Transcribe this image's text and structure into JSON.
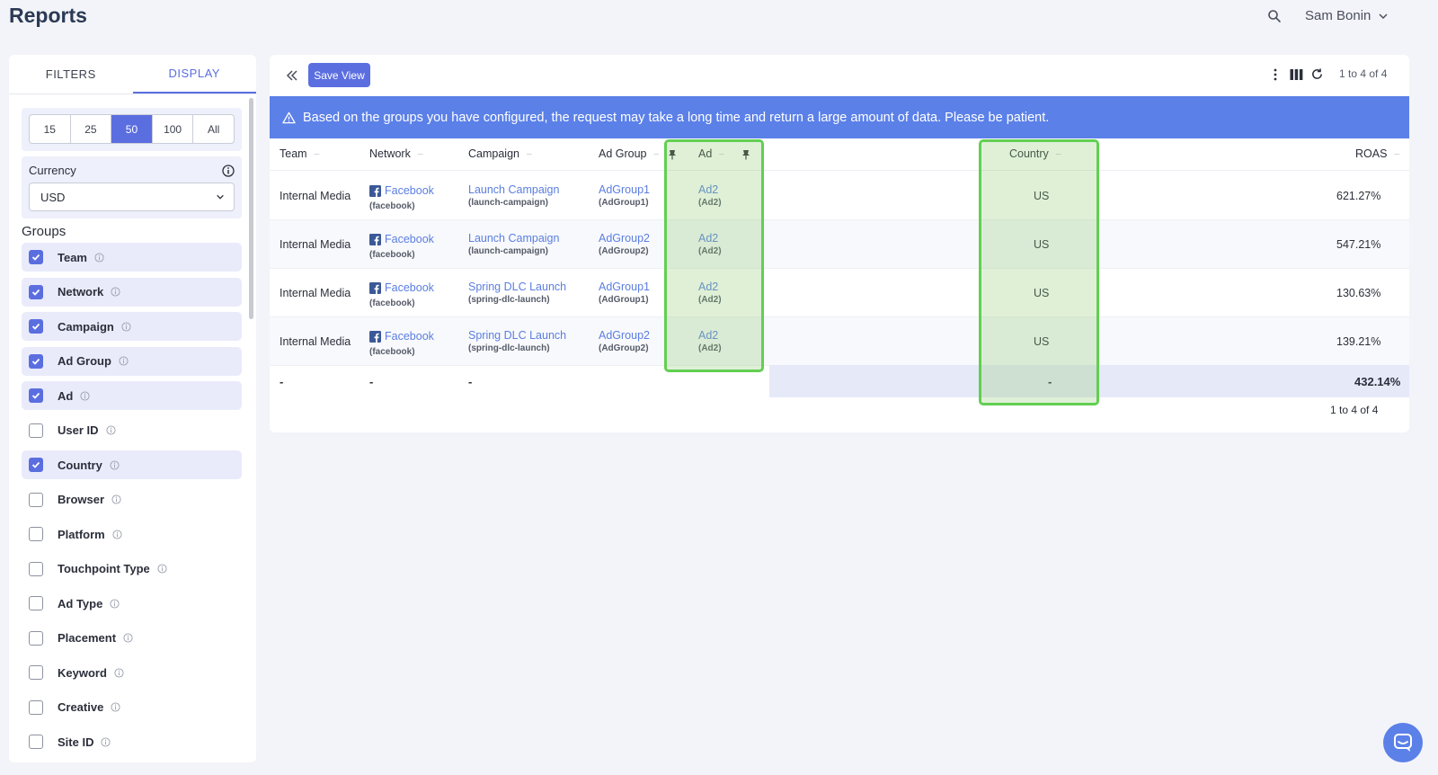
{
  "app": {
    "title": "Reports",
    "user_name": "Sam Bonin"
  },
  "sidebar": {
    "tabs": [
      {
        "label": "FILTERS"
      },
      {
        "label": "DISPLAY"
      }
    ],
    "page_sizes": [
      {
        "label": "15"
      },
      {
        "label": "25"
      },
      {
        "label": "50"
      },
      {
        "label": "100"
      },
      {
        "label": "All"
      }
    ],
    "selected_page_size": "50",
    "currency_label": "Currency",
    "currency_value": "USD",
    "groups_label": "Groups",
    "groups": [
      {
        "label": "Team",
        "checked": true
      },
      {
        "label": "Network",
        "checked": true
      },
      {
        "label": "Campaign",
        "checked": true
      },
      {
        "label": "Ad Group",
        "checked": true
      },
      {
        "label": "Ad",
        "checked": true
      },
      {
        "label": "User ID",
        "checked": false
      },
      {
        "label": "Country",
        "checked": true
      },
      {
        "label": "Browser",
        "checked": false
      },
      {
        "label": "Platform",
        "checked": false
      },
      {
        "label": "Touchpoint Type",
        "checked": false
      },
      {
        "label": "Ad Type",
        "checked": false
      },
      {
        "label": "Placement",
        "checked": false
      },
      {
        "label": "Keyword",
        "checked": false
      },
      {
        "label": "Creative",
        "checked": false
      },
      {
        "label": "Site ID",
        "checked": false
      }
    ]
  },
  "toolbar": {
    "save_view": "Save View",
    "pager": "1 to 4 of 4"
  },
  "warning": {
    "text": "Based on the groups you have configured, the request may take a long time and return a large amount of data. Please be patient."
  },
  "table": {
    "columns": {
      "team": "Team",
      "network": "Network",
      "campaign": "Campaign",
      "adgroup": "Ad Group",
      "ad": "Ad",
      "country": "Country",
      "roas": "ROAS"
    },
    "rows": [
      {
        "team": "Internal Media",
        "network": "Facebook",
        "network_id": "(facebook)",
        "campaign": "Launch Campaign",
        "campaign_id": "(launch-campaign)",
        "adgroup": "AdGroup1",
        "adgroup_id": "(AdGroup1)",
        "ad": "Ad2",
        "ad_id": "(Ad2)",
        "country": "US",
        "roas": "621.27%"
      },
      {
        "team": "Internal Media",
        "network": "Facebook",
        "network_id": "(facebook)",
        "campaign": "Launch Campaign",
        "campaign_id": "(launch-campaign)",
        "adgroup": "AdGroup2",
        "adgroup_id": "(AdGroup2)",
        "ad": "Ad2",
        "ad_id": "(Ad2)",
        "country": "US",
        "roas": "547.21%"
      },
      {
        "team": "Internal Media",
        "network": "Facebook",
        "network_id": "(facebook)",
        "campaign": "Spring DLC Launch",
        "campaign_id": "(spring-dlc-launch)",
        "adgroup": "AdGroup1",
        "adgroup_id": "(AdGroup1)",
        "ad": "Ad2",
        "ad_id": "(Ad2)",
        "country": "US",
        "roas": "130.63%"
      },
      {
        "team": "Internal Media",
        "network": "Facebook",
        "network_id": "(facebook)",
        "campaign": "Spring DLC Launch",
        "campaign_id": "(spring-dlc-launch)",
        "adgroup": "AdGroup2",
        "adgroup_id": "(AdGroup2)",
        "ad": "Ad2",
        "ad_id": "(Ad2)",
        "country": "US",
        "roas": "139.21%"
      }
    ],
    "totals": {
      "team": "-",
      "network": "-",
      "campaign": "-",
      "country": "-",
      "roas": "432.14%"
    },
    "pager": "1 to 4 of 4"
  },
  "colors": {
    "accent": "#5b6ee0",
    "banner": "#5b80e8",
    "highlight": "#62cf52"
  },
  "icons": [
    "search-icon",
    "chevron-down-icon",
    "info-icon",
    "collapse-icon",
    "more-vert-icon",
    "columns-icon",
    "refresh-icon",
    "warning-icon",
    "pin-icon",
    "facebook-icon",
    "chat-icon"
  ]
}
